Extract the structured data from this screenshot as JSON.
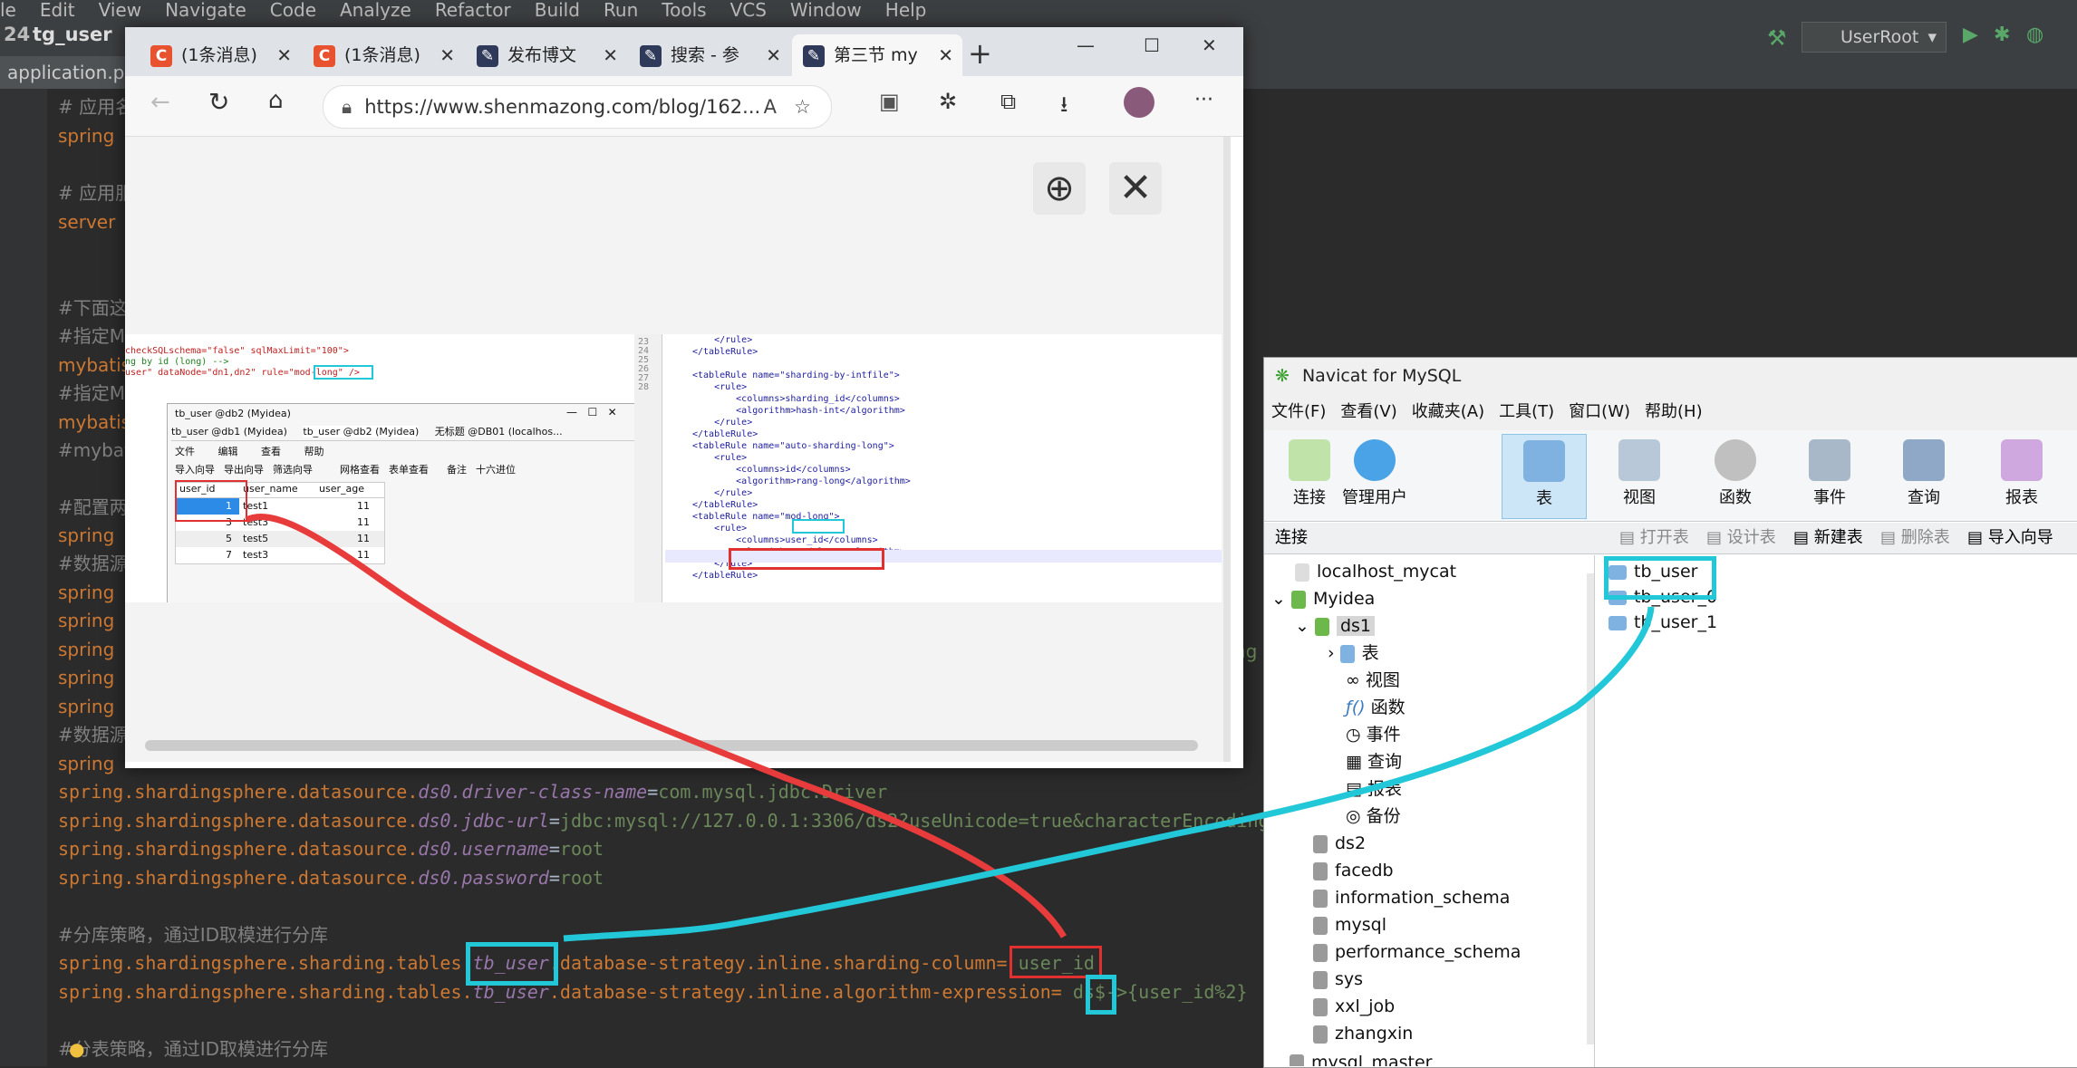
{
  "ide": {
    "menu": [
      "le",
      "Edit",
      "View",
      "Navigate",
      "Code",
      "Analyze",
      "Refactor",
      "Build",
      "Run",
      "Tools",
      "VCS",
      "Window",
      "Help"
    ],
    "breadcrumb_num": "24",
    "breadcrumb_project": "tg_user",
    "tab_file": "application.pro",
    "run_config": "UserRoot",
    "code": [
      {
        "k": "comment",
        "t": "# 应用名"
      },
      {
        "k": "key",
        "t": "spring"
      },
      {
        "k": "comment",
        "t": "# 应用服"
      },
      {
        "k": "key",
        "t": "server"
      },
      {
        "k": "comment",
        "t": "#下面这"
      },
      {
        "k": "comment",
        "t": "#指定My"
      },
      {
        "k": "key",
        "t": "mybatis"
      },
      {
        "k": "comment",
        "t": "#指定My"
      },
      {
        "k": "key",
        "t": "mybatis"
      },
      {
        "k": "comment",
        "t": "#mybat"
      },
      {
        "k": "comment",
        "t": "#配置两"
      },
      {
        "k": "key",
        "t": "spring"
      },
      {
        "k": "comment",
        "t": "#数据源"
      },
      {
        "k": "key",
        "t": "spring"
      },
      {
        "k": "key",
        "t": "spring"
      },
      {
        "k": "key",
        "t": "spring"
      },
      {
        "k": "key",
        "t": "spring"
      },
      {
        "k": "key",
        "t": "spring"
      },
      {
        "k": "comment",
        "t": "#数据源2"
      },
      {
        "k": "key",
        "t": "spring"
      }
    ],
    "line_ds0_driver": {
      "a": "spring.shardingsphere.datasource.",
      "b": "ds0.driver-class-name",
      "c": "=",
      "d": "com.mysql.jdbc.Driver"
    },
    "line_ds0_url": {
      "a": "spring.shardingsphere.datasource.",
      "b": "ds0.jdbc-url",
      "c": "=",
      "d": "jdbc:mysql://127.0.0.1:3306/ds2?useUnicode=true&characterEncoding"
    },
    "line_ds0_user": {
      "a": "spring.shardingsphere.datasource.",
      "b": "ds0.username",
      "c": "=",
      "d": "root"
    },
    "line_ds0_pass": {
      "a": "spring.shardingsphere.datasource.",
      "b": "ds0.password",
      "c": "=",
      "d": "root"
    },
    "comment_db_strategy": "#分库策略，通过ID取模进行分库",
    "line_sharding_col": {
      "a": "spring.shardingsphere.sharding.tables.",
      "b": "tb_user",
      "c": ".database-strategy.inline.sharding-column=",
      "d": "user_id"
    },
    "line_algo": {
      "a": "spring.shardingsphere.sharding.tables.",
      "b": "tb_user",
      "c": ".database-strategy.inline.algorithm-expression=",
      "d": "ds$->{user_id%2}"
    },
    "comment_table_strategy": "#分表策略，通过ID取模进行分库",
    "right_edge_text": "ng"
  },
  "browser": {
    "tabs": [
      {
        "label": "(1条消息)",
        "icon": "C",
        "color": "#e8522e"
      },
      {
        "label": "(1条消息)",
        "icon": "C",
        "color": "#e8522e"
      },
      {
        "label": "发布博文",
        "icon": "✎",
        "color": "#2f3a5a"
      },
      {
        "label": "搜索 - 参",
        "icon": "✎",
        "color": "#2f3a5a"
      },
      {
        "label": "第三节 my",
        "icon": "✎",
        "color": "#2f3a5a"
      }
    ],
    "new_tab": "+",
    "win_controls": [
      "—",
      "☐",
      "✕"
    ],
    "url": "https://www.shenmazong.com/blog/162...",
    "read_aloud": "A",
    "more": "···"
  },
  "inner_shot": {
    "xml_left": [
      "checkSQLschema=\"false\" sqlMaxLimit=\"100\">",
      "ng by id (long) -->",
      "user\" dataNode=\"dn1,dn2\" rule=\"mod-long\" />"
    ],
    "mini_window_title": "tb_user @db2 (Myidea)",
    "mini_tabs": [
      "tb_user @db1 (Myidea)",
      "tb_user @db2 (Myidea)",
      "无标题 @DB01 (localhos..."
    ],
    "mini_menu": [
      "文件",
      "编辑",
      "查看",
      "帮助"
    ],
    "mini_tools": [
      "导入向导",
      "导出向导",
      "筛选向导",
      "网格查看",
      "表单查看",
      "备注",
      "十六进位"
    ],
    "mini_columns": [
      "user_id",
      "user_name",
      "user_age"
    ],
    "mini_rows": [
      [
        "1",
        "test1",
        "11"
      ],
      [
        "3",
        "test3",
        "11"
      ],
      [
        "5",
        "test5",
        "11"
      ],
      [
        "7",
        "test3",
        "11"
      ]
    ],
    "line_nums": [
      "23",
      "24",
      "25",
      "26",
      "27",
      "28"
    ],
    "xml_right": [
      "    </rule>",
      "</tableRule>",
      "",
      "<tableRule name=\"sharding-by-intfile\">",
      "    <rule>",
      "        <columns>sharding_id</columns>",
      "        <algorithm>hash-int</algorithm>",
      "    </rule>",
      "</tableRule>",
      "<tableRule name=\"auto-sharding-long\">",
      "    <rule>",
      "        <columns>id</columns>",
      "        <algorithm>rang-long</algorithm>",
      "    </rule>",
      "</tableRule>",
      "<tableRule name=\"mod-long\">",
      "    <rule>",
      "        <columns>user_id</columns>",
      "        <algorithm>mod-long</algorithm>",
      "    </rule>",
      "</tableRule>"
    ]
  },
  "navicat": {
    "title": "Navicat for MySQL",
    "menu": [
      "文件(F)",
      "查看(V)",
      "收藏夹(A)",
      "工具(T)",
      "窗口(W)",
      "帮助(H)"
    ],
    "tools": [
      "连接",
      "管理用户",
      "表",
      "视图",
      "函数",
      "事件",
      "查询",
      "报表"
    ],
    "conn_label": "连接",
    "actions": [
      "打开表",
      "设计表",
      "新建表",
      "删除表",
      "导入向导"
    ],
    "tree": {
      "localhost": "localhost_mycat",
      "myidea": "Myidea",
      "ds1": "ds1",
      "ds1_children": [
        "表",
        "视图",
        "函数",
        "事件",
        "查询",
        "报表",
        "备份"
      ],
      "dbs": [
        "ds2",
        "facedb",
        "information_schema",
        "mysql",
        "performance_schema",
        "sys",
        "xxl_job",
        "zhangxin"
      ],
      "last": "mysql_master"
    },
    "tables": [
      "tb_user",
      "tb_user_0",
      "tb_user_1"
    ]
  },
  "colors": {
    "cyan": "#22c8d8",
    "red": "#e03030"
  }
}
